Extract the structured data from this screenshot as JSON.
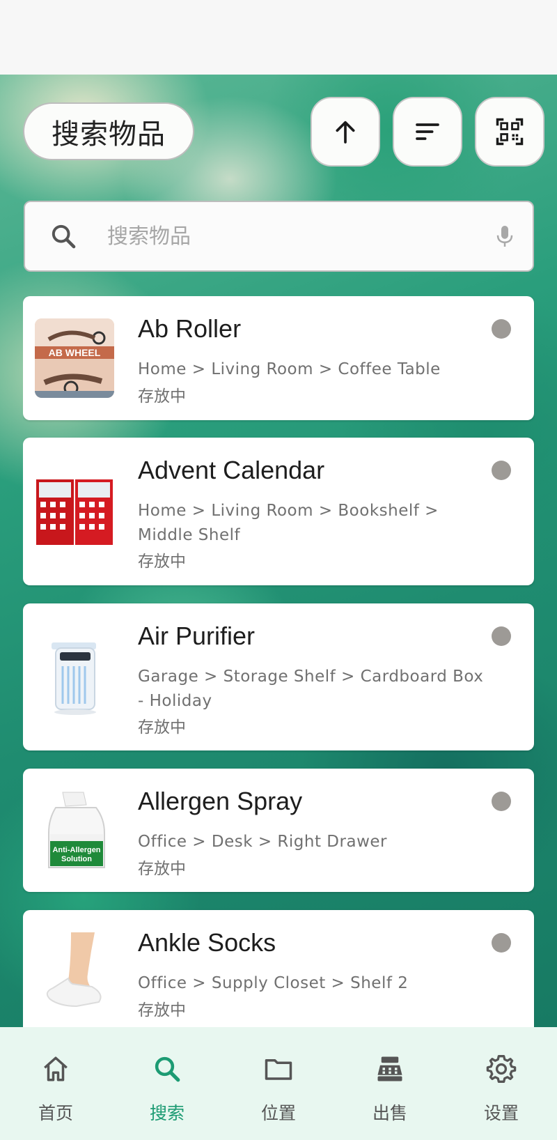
{
  "header": {
    "title": "搜索物品",
    "sort_direction_icon": "arrow-up-icon",
    "sort_icon": "sort-icon",
    "scan_icon": "qr-scan-icon"
  },
  "search": {
    "placeholder": "搜索物品",
    "value": ""
  },
  "items": [
    {
      "name": "Ab Roller",
      "path": "Home > Living Room > Coffee Table",
      "status": "存放中"
    },
    {
      "name": "Advent Calendar",
      "path": "Home > Living Room > Bookshelf > Middle Shelf",
      "status": "存放中"
    },
    {
      "name": "Air Purifier",
      "path": "Garage > Storage Shelf > Cardboard Box - Holiday",
      "status": "存放中"
    },
    {
      "name": "Allergen Spray",
      "path": "Office > Desk > Right Drawer",
      "status": "存放中"
    },
    {
      "name": "Ankle Socks",
      "path": "Office > Supply Closet > Shelf 2",
      "status": "存放中"
    }
  ],
  "thumbnails": {
    "ab_roller_text": "AB WHEEL",
    "allergen_text_1": "Anti-Allergen",
    "allergen_text_2": "Solution"
  },
  "nav": {
    "items": [
      {
        "label": "首页",
        "icon": "home-icon"
      },
      {
        "label": "搜索",
        "icon": "search-icon"
      },
      {
        "label": "位置",
        "icon": "folder-icon"
      },
      {
        "label": "出售",
        "icon": "cash-register-icon"
      },
      {
        "label": "设置",
        "icon": "gear-icon"
      }
    ],
    "active": "搜索"
  },
  "colors": {
    "accent": "#1c9b73",
    "nav_background": "#e8f7f0",
    "status_dot": "#9d9a96"
  }
}
